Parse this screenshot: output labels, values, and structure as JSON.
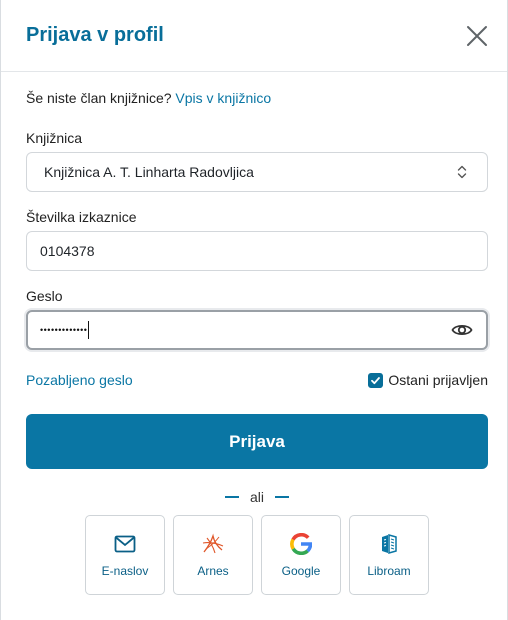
{
  "dialog": {
    "title": "Prijava v profil"
  },
  "signup": {
    "question": "Še niste član knjižnice?",
    "link": "Vpis v knjižnico"
  },
  "library": {
    "label": "Knjižnica",
    "selected": "Knjižnica A. T. Linharta Radovljica"
  },
  "card": {
    "label": "Številka izkaznice",
    "value": "0104378"
  },
  "password": {
    "label": "Geslo",
    "value": "•••••••••••••"
  },
  "forgot_link": "Pozabljeno geslo",
  "remember": {
    "label": "Ostani prijavljen",
    "checked": true
  },
  "submit_label": "Prijava",
  "divider_text": "ali",
  "providers": [
    {
      "label": "E-naslov",
      "icon": "mail-icon"
    },
    {
      "label": "Arnes",
      "icon": "arnes-icon"
    },
    {
      "label": "Google",
      "icon": "google-icon"
    },
    {
      "label": "Libroam",
      "icon": "libroam-icon"
    }
  ],
  "colors": {
    "accent": "#0a76a4",
    "title": "#086e99",
    "arnes": "#e0572a"
  }
}
